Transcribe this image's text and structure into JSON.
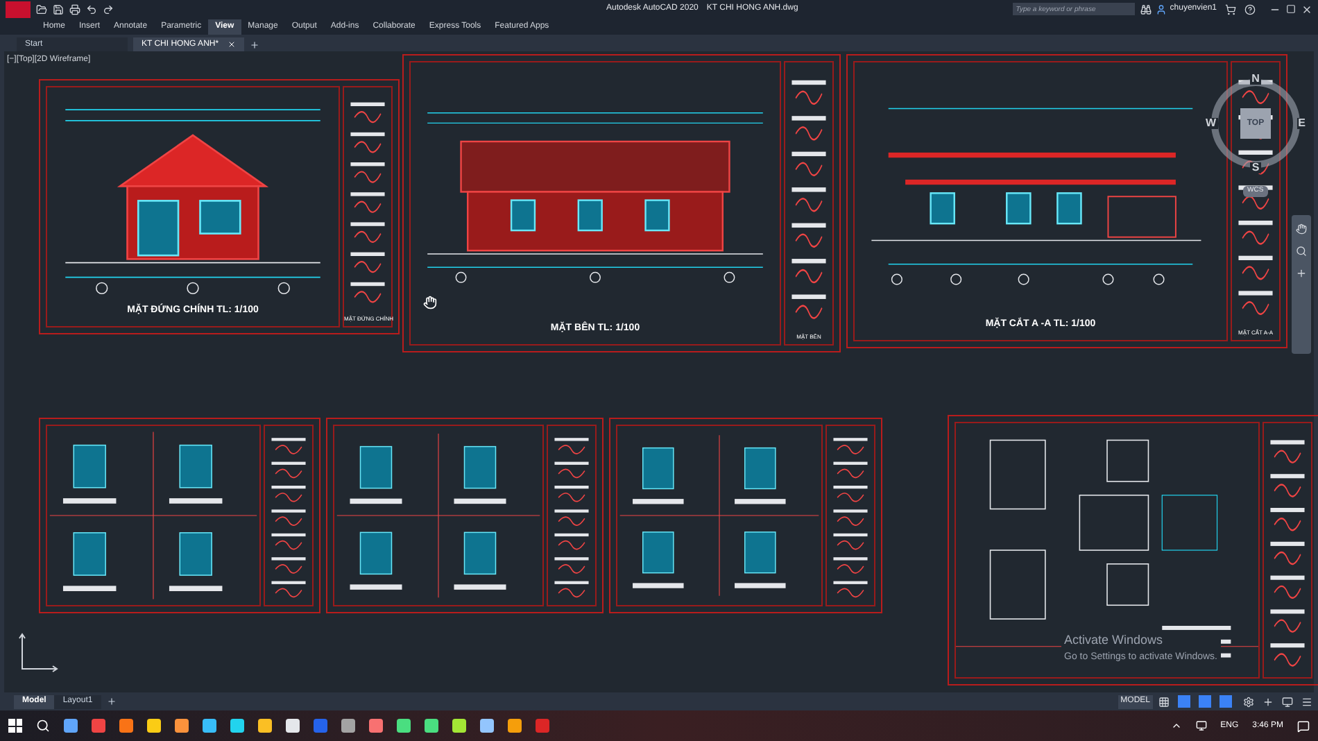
{
  "title_bar": {
    "app_title": "Autodesk AutoCAD 2020",
    "file_name": "KT CHI HONG ANH.dwg",
    "search": {
      "placeholder": "Type a keyword or phrase"
    },
    "user": "chuyenvien1"
  },
  "ribbon_tabs": [
    {
      "label": "Home",
      "selected": false
    },
    {
      "label": "Insert",
      "selected": false
    },
    {
      "label": "Annotate",
      "selected": false
    },
    {
      "label": "Parametric",
      "selected": false
    },
    {
      "label": "View",
      "selected": true
    },
    {
      "label": "Manage",
      "selected": false
    },
    {
      "label": "Output",
      "selected": false
    },
    {
      "label": "Add-ins",
      "selected": false
    },
    {
      "label": "Collaborate",
      "selected": false
    },
    {
      "label": "Express Tools",
      "selected": false
    },
    {
      "label": "Featured Apps",
      "selected": false
    }
  ],
  "file_tabs": [
    {
      "label": "Start",
      "selected": false
    },
    {
      "label": "KT CHI HONG ANH*",
      "selected": true
    }
  ],
  "viewport_label": "[−][Top][2D Wireframe]",
  "sheets": [
    {
      "kind": "front_elevation",
      "title": "MẶT ĐỨNG CHÍNH TL: 1/100",
      "block_label": "MẶT ĐỨNG CHÍNH"
    },
    {
      "kind": "side_elevation",
      "title": "MẶT BÊN TL: 1/100",
      "block_label": "MẶT BÊN"
    },
    {
      "kind": "section",
      "title": "MẶT CẮT A -A TL: 1/100",
      "block_label": "MẶT CẮT A-A"
    },
    {
      "kind": "door_details"
    },
    {
      "kind": "door_details"
    },
    {
      "kind": "door_details"
    },
    {
      "kind": "wc_plans"
    }
  ],
  "viewcube": {
    "north": "N",
    "south": "S",
    "east": "E",
    "west": "W",
    "face": "TOP",
    "ucs": "WCS"
  },
  "activation": {
    "heading": "Activate Windows",
    "hint": "Go to Settings to activate Windows."
  },
  "layout_tabs": [
    {
      "label": "Model",
      "selected": true
    },
    {
      "label": "Layout1",
      "selected": false
    }
  ],
  "status_bar": {
    "mode": "MODEL"
  },
  "taskbar": {
    "language": "ENG",
    "time": "3:46 PM"
  }
}
